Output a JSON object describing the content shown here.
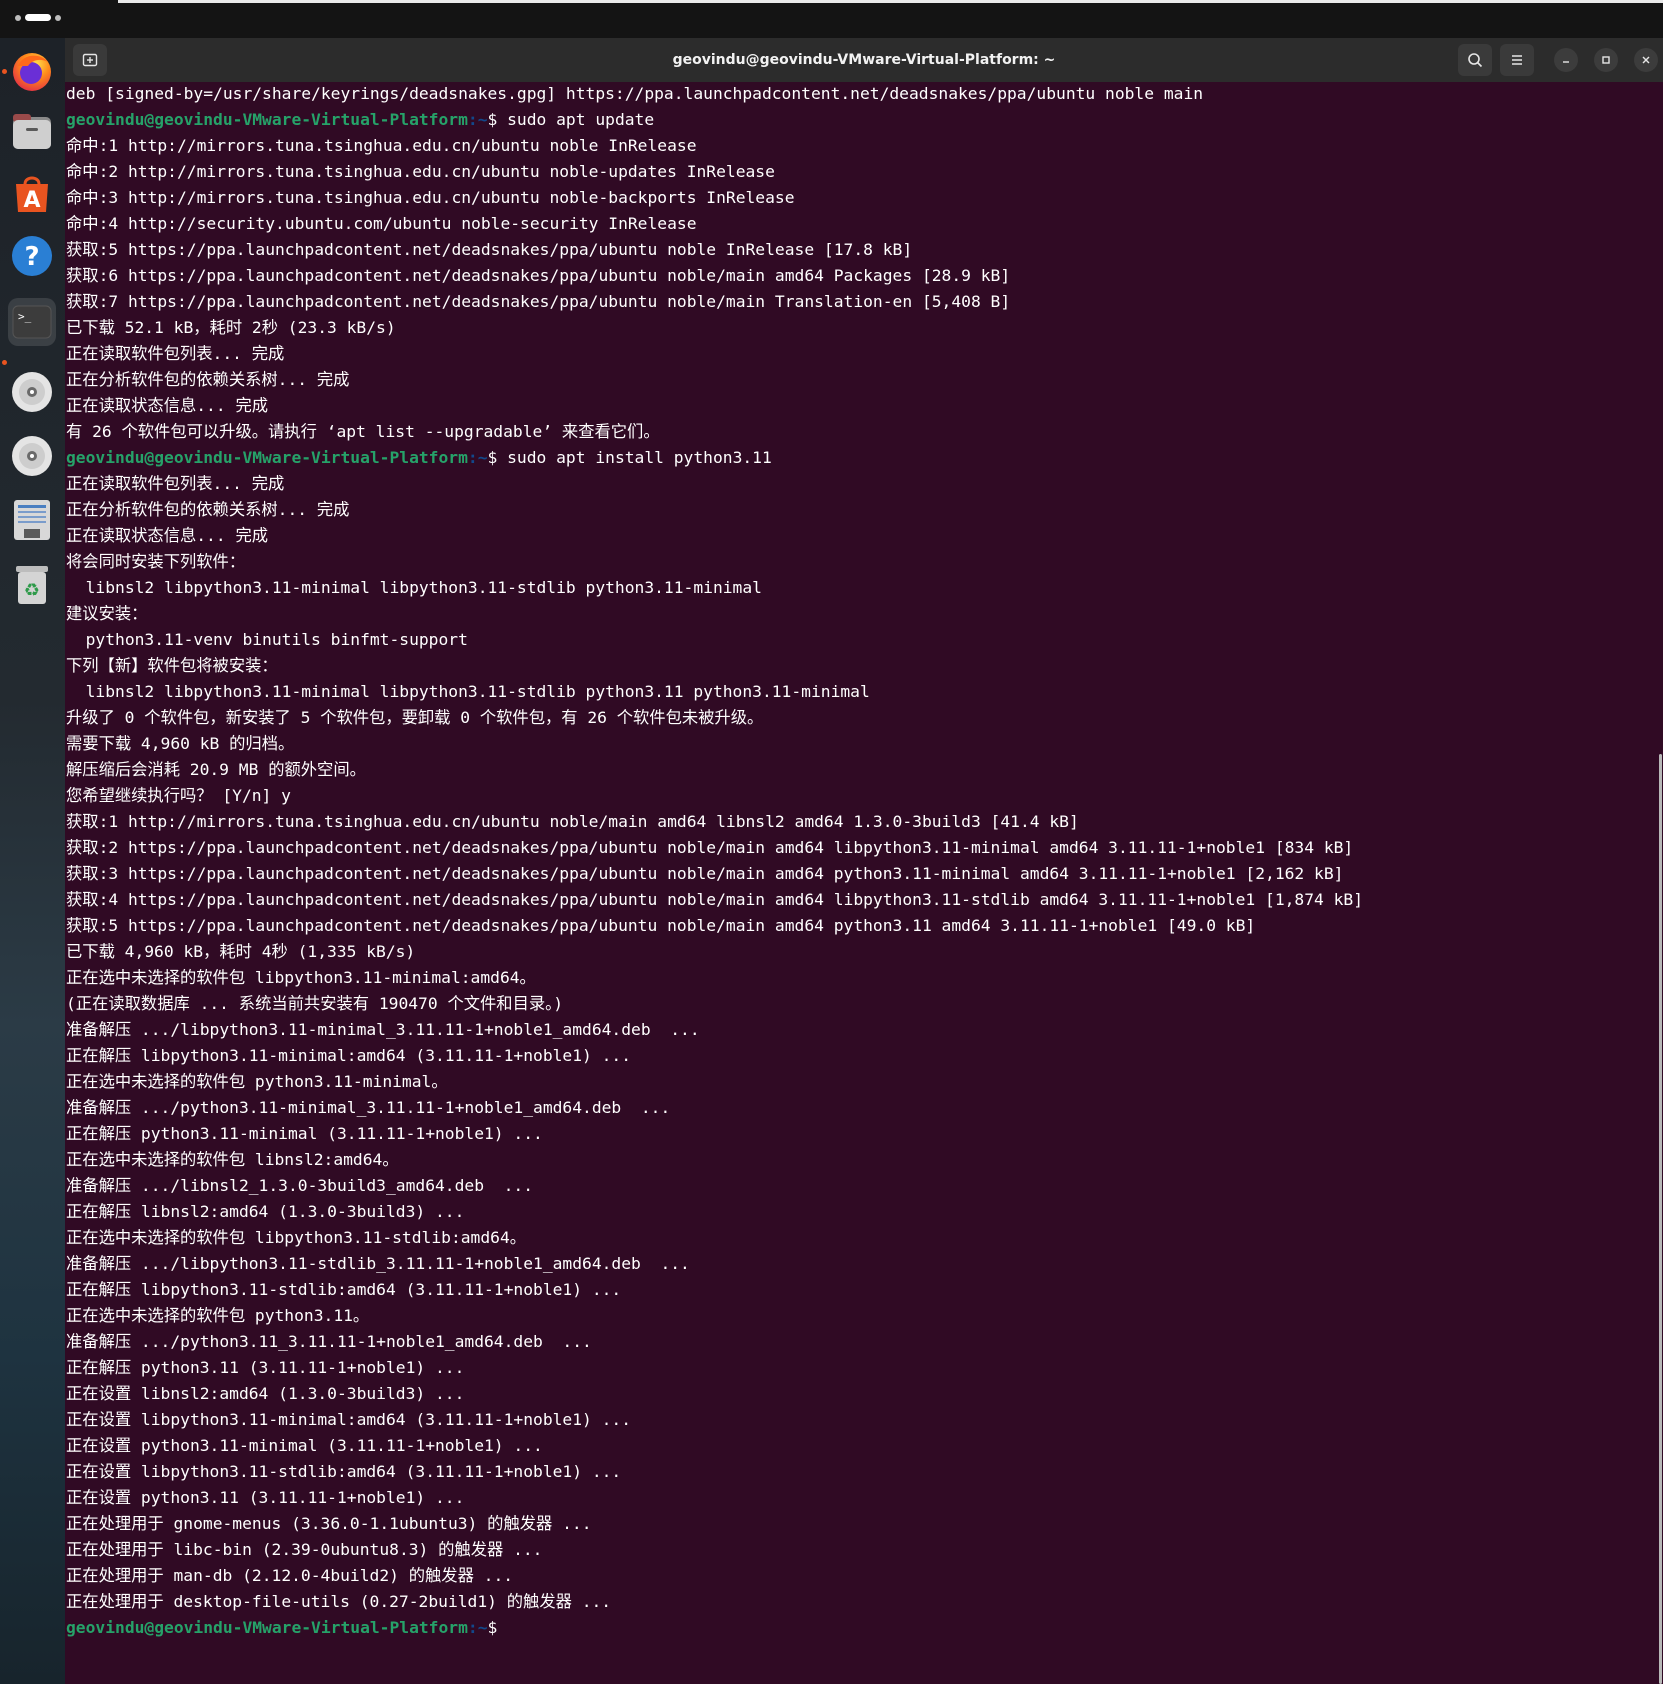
{
  "window": {
    "title": "geovindu@geovindu-VMware-Virtual-Platform: ~"
  },
  "dock": {
    "items": [
      {
        "name": "firefox"
      },
      {
        "name": "files"
      },
      {
        "name": "app-center"
      },
      {
        "name": "help"
      },
      {
        "name": "terminal"
      },
      {
        "name": "disc-1"
      },
      {
        "name": "disc-2"
      },
      {
        "name": "text-editor"
      },
      {
        "name": "trash"
      }
    ]
  },
  "prompt": {
    "user_host": "geovindu@geovindu-VMware-Virtual-Platform",
    "path": ":~",
    "dollar": "$"
  },
  "terminal": {
    "lines": [
      {
        "type": "text",
        "text": "deb [signed-by=/usr/share/keyrings/deadsnakes.gpg] https://ppa.launchpadcontent.net/deadsnakes/ppa/ubuntu noble main"
      },
      {
        "type": "prompt",
        "cmd": " sudo apt update"
      },
      {
        "type": "text",
        "text": "命中:1 http://mirrors.tuna.tsinghua.edu.cn/ubuntu noble InRelease"
      },
      {
        "type": "text",
        "text": "命中:2 http://mirrors.tuna.tsinghua.edu.cn/ubuntu noble-updates InRelease"
      },
      {
        "type": "text",
        "text": "命中:3 http://mirrors.tuna.tsinghua.edu.cn/ubuntu noble-backports InRelease"
      },
      {
        "type": "text",
        "text": "命中:4 http://security.ubuntu.com/ubuntu noble-security InRelease"
      },
      {
        "type": "text",
        "text": "获取:5 https://ppa.launchpadcontent.net/deadsnakes/ppa/ubuntu noble InRelease [17.8 kB]"
      },
      {
        "type": "text",
        "text": "获取:6 https://ppa.launchpadcontent.net/deadsnakes/ppa/ubuntu noble/main amd64 Packages [28.9 kB]"
      },
      {
        "type": "text",
        "text": "获取:7 https://ppa.launchpadcontent.net/deadsnakes/ppa/ubuntu noble/main Translation-en [5,408 B]"
      },
      {
        "type": "text",
        "text": "已下载 52.1 kB，耗时 2秒 (23.3 kB/s)"
      },
      {
        "type": "text",
        "text": "正在读取软件包列表... 完成"
      },
      {
        "type": "text",
        "text": "正在分析软件包的依赖关系树... 完成"
      },
      {
        "type": "text",
        "text": "正在读取状态信息... 完成"
      },
      {
        "type": "text",
        "text": "有 26 个软件包可以升级。请执行 ‘apt list --upgradable’ 来查看它们。"
      },
      {
        "type": "prompt",
        "cmd": " sudo apt install python3.11"
      },
      {
        "type": "text",
        "text": "正在读取软件包列表... 完成"
      },
      {
        "type": "text",
        "text": "正在分析软件包的依赖关系树... 完成"
      },
      {
        "type": "text",
        "text": "正在读取状态信息... 完成"
      },
      {
        "type": "text",
        "text": "将会同时安装下列软件："
      },
      {
        "type": "text",
        "text": "  libnsl2 libpython3.11-minimal libpython3.11-stdlib python3.11-minimal"
      },
      {
        "type": "text",
        "text": "建议安装："
      },
      {
        "type": "text",
        "text": "  python3.11-venv binutils binfmt-support"
      },
      {
        "type": "text",
        "text": "下列【新】软件包将被安装："
      },
      {
        "type": "text",
        "text": "  libnsl2 libpython3.11-minimal libpython3.11-stdlib python3.11 python3.11-minimal"
      },
      {
        "type": "text",
        "text": "升级了 0 个软件包，新安装了 5 个软件包，要卸载 0 个软件包，有 26 个软件包未被升级。"
      },
      {
        "type": "text",
        "text": "需要下载 4,960 kB 的归档。"
      },
      {
        "type": "text",
        "text": "解压缩后会消耗 20.9 MB 的额外空间。"
      },
      {
        "type": "text",
        "text": "您希望继续执行吗？ [Y/n] y"
      },
      {
        "type": "text",
        "text": "获取:1 http://mirrors.tuna.tsinghua.edu.cn/ubuntu noble/main amd64 libnsl2 amd64 1.3.0-3build3 [41.4 kB]"
      },
      {
        "type": "text",
        "text": "获取:2 https://ppa.launchpadcontent.net/deadsnakes/ppa/ubuntu noble/main amd64 libpython3.11-minimal amd64 3.11.11-1+noble1 [834 kB]"
      },
      {
        "type": "text",
        "text": "获取:3 https://ppa.launchpadcontent.net/deadsnakes/ppa/ubuntu noble/main amd64 python3.11-minimal amd64 3.11.11-1+noble1 [2,162 kB]"
      },
      {
        "type": "text",
        "text": "获取:4 https://ppa.launchpadcontent.net/deadsnakes/ppa/ubuntu noble/main amd64 libpython3.11-stdlib amd64 3.11.11-1+noble1 [1,874 kB]"
      },
      {
        "type": "text",
        "text": "获取:5 https://ppa.launchpadcontent.net/deadsnakes/ppa/ubuntu noble/main amd64 python3.11 amd64 3.11.11-1+noble1 [49.0 kB]"
      },
      {
        "type": "text",
        "text": "已下载 4,960 kB，耗时 4秒 (1,335 kB/s)"
      },
      {
        "type": "text",
        "text": "正在选中未选择的软件包 libpython3.11-minimal:amd64。"
      },
      {
        "type": "text",
        "text": "(正在读取数据库 ... 系统当前共安装有 190470 个文件和目录。)"
      },
      {
        "type": "text",
        "text": "准备解压 .../libpython3.11-minimal_3.11.11-1+noble1_amd64.deb  ..."
      },
      {
        "type": "text",
        "text": "正在解压 libpython3.11-minimal:amd64 (3.11.11-1+noble1) ..."
      },
      {
        "type": "text",
        "text": "正在选中未选择的软件包 python3.11-minimal。"
      },
      {
        "type": "text",
        "text": "准备解压 .../python3.11-minimal_3.11.11-1+noble1_amd64.deb  ..."
      },
      {
        "type": "text",
        "text": "正在解压 python3.11-minimal (3.11.11-1+noble1) ..."
      },
      {
        "type": "text",
        "text": "正在选中未选择的软件包 libnsl2:amd64。"
      },
      {
        "type": "text",
        "text": "准备解压 .../libnsl2_1.3.0-3build3_amd64.deb  ..."
      },
      {
        "type": "text",
        "text": "正在解压 libnsl2:amd64 (1.3.0-3build3) ..."
      },
      {
        "type": "text",
        "text": "正在选中未选择的软件包 libpython3.11-stdlib:amd64。"
      },
      {
        "type": "text",
        "text": "准备解压 .../libpython3.11-stdlib_3.11.11-1+noble1_amd64.deb  ..."
      },
      {
        "type": "text",
        "text": "正在解压 libpython3.11-stdlib:amd64 (3.11.11-1+noble1) ..."
      },
      {
        "type": "text",
        "text": "正在选中未选择的软件包 python3.11。"
      },
      {
        "type": "text",
        "text": "准备解压 .../python3.11_3.11.11-1+noble1_amd64.deb  ..."
      },
      {
        "type": "text",
        "text": "正在解压 python3.11 (3.11.11-1+noble1) ..."
      },
      {
        "type": "text",
        "text": "正在设置 libnsl2:amd64 (1.3.0-3build3) ..."
      },
      {
        "type": "text",
        "text": "正在设置 libpython3.11-minimal:amd64 (3.11.11-1+noble1) ..."
      },
      {
        "type": "text",
        "text": "正在设置 python3.11-minimal (3.11.11-1+noble1) ..."
      },
      {
        "type": "text",
        "text": "正在设置 libpython3.11-stdlib:amd64 (3.11.11-1+noble1) ..."
      },
      {
        "type": "text",
        "text": "正在设置 python3.11 (3.11.11-1+noble1) ..."
      },
      {
        "type": "text",
        "text": "正在处理用于 gnome-menus (3.36.0-1.1ubuntu3) 的触发器 ..."
      },
      {
        "type": "text",
        "text": "正在处理用于 libc-bin (2.39-0ubuntu8.3) 的触发器 ..."
      },
      {
        "type": "text",
        "text": "正在处理用于 man-db (2.12.0-4build2) 的触发器 ..."
      },
      {
        "type": "text",
        "text": "正在处理用于 desktop-file-utils (0.27-2build1) 的触发器 ..."
      },
      {
        "type": "prompt",
        "cmd": ""
      }
    ]
  },
  "colors": {
    "terminal_bg": "#300a24",
    "prompt_user": "#26a269",
    "prompt_path": "#12488b",
    "text": "#ffffff",
    "accent": "#e95420"
  }
}
